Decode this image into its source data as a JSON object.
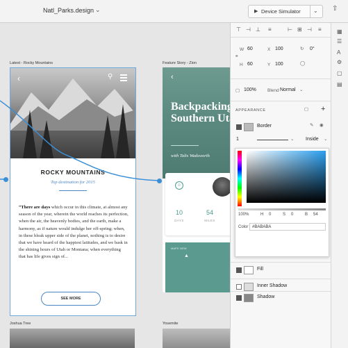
{
  "topbar": {
    "doc_title": "Natl_Parks.design",
    "device_sim_label": "Device Simulator"
  },
  "artboards": {
    "a1": {
      "label": "Latest - Rocky Mountains",
      "title": "ROCKY MOUNTAINS",
      "subtitle": "Top destination for 2015",
      "body_lead": "“There are days",
      "body_text": " which occur in this climate, at almost any season of the year, wherein the world reaches its perfection, when the air, the heavenly bodies, and the earth, make a harmony, as if nature would indulge her off-spring; when, in these bleak upper side of the planet, nothing is to desire that we have heard of the happiest latitudes, and we bask in the shining hours of Utah or Montana; when everything that has life gives sign of...",
      "button": "SEE MORE"
    },
    "a2": {
      "label": "Feature Story - Zion",
      "title": "Backpacking Through Southern Utah",
      "author": "with Talis Wadsworth",
      "stats": [
        {
          "value": "10",
          "label": "DAYS"
        },
        {
          "value": "54",
          "label": "MILES"
        }
      ],
      "map_label": "MAPS VIEW"
    },
    "a3": {
      "label": "Joshua Tree"
    },
    "a4": {
      "label": "Yosemite"
    }
  },
  "properties": {
    "w_label": "W",
    "w": "60",
    "h_label": "H",
    "h": "60",
    "x_label": "X",
    "x": "100",
    "y_label": "Y",
    "y": "100",
    "rotation": "0°",
    "opacity": "100%",
    "blend_label": "Blend",
    "blend": "Normal",
    "appearance_label": "APPEARANCE",
    "border_label": "Border",
    "border_width": "1",
    "border_position": "Inside",
    "alpha": "100%",
    "h_val": "0",
    "s_val": "0",
    "b_val": "54",
    "color_label": "Color",
    "color_hex": "#BABABA",
    "fill_label": "Fill",
    "inner_shadow_label": "Inner Shadow",
    "shadow_label": "Shadow"
  },
  "colors": {
    "accent": "#3a8fd6",
    "teal": "#4a9b8f",
    "border_swatch": "#bababa"
  }
}
